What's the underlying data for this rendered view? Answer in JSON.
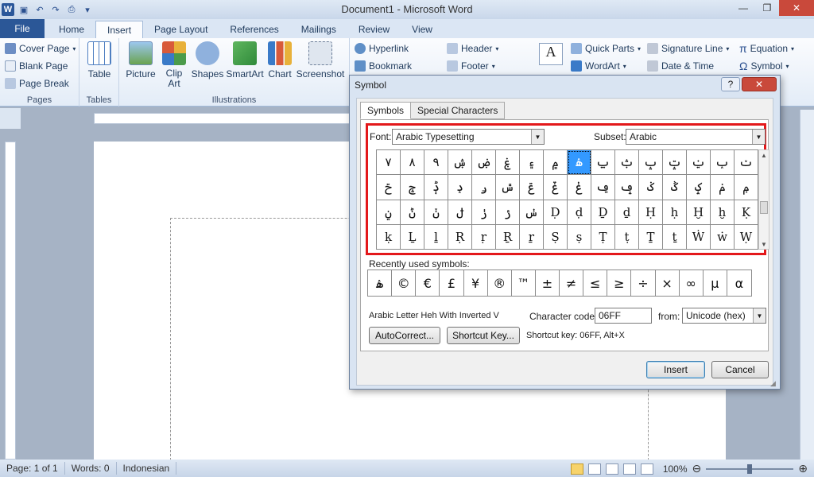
{
  "window": {
    "title": "Document1 - Microsoft Word",
    "controls": {
      "minimize": "—",
      "maximize": "❐",
      "close": "✕"
    }
  },
  "quick_access": {
    "logo": "W",
    "save": "▣",
    "undo": "↶",
    "redo": "↷",
    "print": "⎙",
    "more": "▾"
  },
  "ribbon_tabs": [
    "File",
    "Home",
    "Insert",
    "Page Layout",
    "References",
    "Mailings",
    "Review",
    "View"
  ],
  "ribbon": {
    "pages": {
      "items": [
        "Cover Page",
        "Blank Page",
        "Page Break"
      ],
      "label": "Pages"
    },
    "tables": {
      "table": "Table",
      "label": "Tables"
    },
    "illustrations": {
      "picture": "Picture",
      "clip_art": "Clip Art",
      "shapes": "Shapes",
      "smartart": "SmartArt",
      "chart": "Chart",
      "screenshot": "Screenshot",
      "label": "Illustrations"
    },
    "links": {
      "hyperlink": "Hyperlink",
      "bookmark": "Bookmark"
    },
    "header_footer": {
      "header": "Header",
      "footer": "Footer"
    },
    "text": {
      "quick_parts": "Quick Parts",
      "wordart": "WordArt",
      "signature_line": "Signature Line",
      "date_time": "Date & Time"
    },
    "symbols": {
      "equation": "Equation",
      "symbol": "Symbol"
    }
  },
  "dialog": {
    "title": "Symbol",
    "help": "?",
    "close": "✕",
    "tabs": [
      "Symbols",
      "Special Characters"
    ],
    "font_label": "Font:",
    "font_value": "Arabic Typesetting",
    "subset_label": "Subset:",
    "subset_value": "Arabic",
    "grid": [
      [
        "۷",
        "۸",
        "۹",
        "ۺ",
        "ۻ",
        "ۼ",
        "۽",
        "۾",
        "ۿ",
        "ݐ",
        "ݑ",
        "ݒ",
        "ݓ",
        "ݔ",
        "ݕ",
        "ݖ"
      ],
      [
        "ݗ",
        "ݘ",
        "ݙ",
        "ݚ",
        "ݛ",
        "ݜ",
        "ݝ",
        "ݞ",
        "ݟ",
        "ݠ",
        "ݡ",
        "ݢ",
        "ݣ",
        "ݤ",
        "ݥ",
        "ݦ"
      ],
      [
        "ݧ",
        "ݨ",
        "ݩ",
        "ݪ",
        "ݫ",
        "ݬ",
        "ݭ",
        "Ḍ",
        "ḍ",
        "Ḏ",
        "ḏ",
        "Ḥ",
        "ḥ",
        "Ḫ",
        "ḫ",
        "Ḳ"
      ],
      [
        "ḳ",
        "Ḻ",
        "ḻ",
        "Ṛ",
        "ṛ",
        "Ṟ",
        "ṟ",
        "Ṣ",
        "ṣ",
        "Ṭ",
        "ṭ",
        "Ṯ",
        "ṯ",
        "Ẇ",
        "ẇ",
        "Ẉ"
      ]
    ],
    "selected_index": 8,
    "recent_label": "Recently used symbols:",
    "recent": [
      "ۿ",
      "©",
      "€",
      "£",
      "¥",
      "®",
      "™",
      "±",
      "≠",
      "≤",
      "≥",
      "÷",
      "×",
      "∞",
      "µ",
      "α"
    ],
    "char_name": "Arabic Letter Heh With Inverted V",
    "char_code_label": "Character code:",
    "char_code_value": "06FF",
    "from_label": "from:",
    "from_value": "Unicode (hex)",
    "autocorrect": "AutoCorrect...",
    "shortcut_key_btn": "Shortcut Key...",
    "shortcut_info": "Shortcut key: 06FF, Alt+X",
    "insert": "Insert",
    "cancel": "Cancel"
  },
  "status": {
    "page": "Page: 1 of 1",
    "words": "Words: 0",
    "language": "Indonesian",
    "zoom": "100%",
    "zoom_fraction": 0.5
  }
}
